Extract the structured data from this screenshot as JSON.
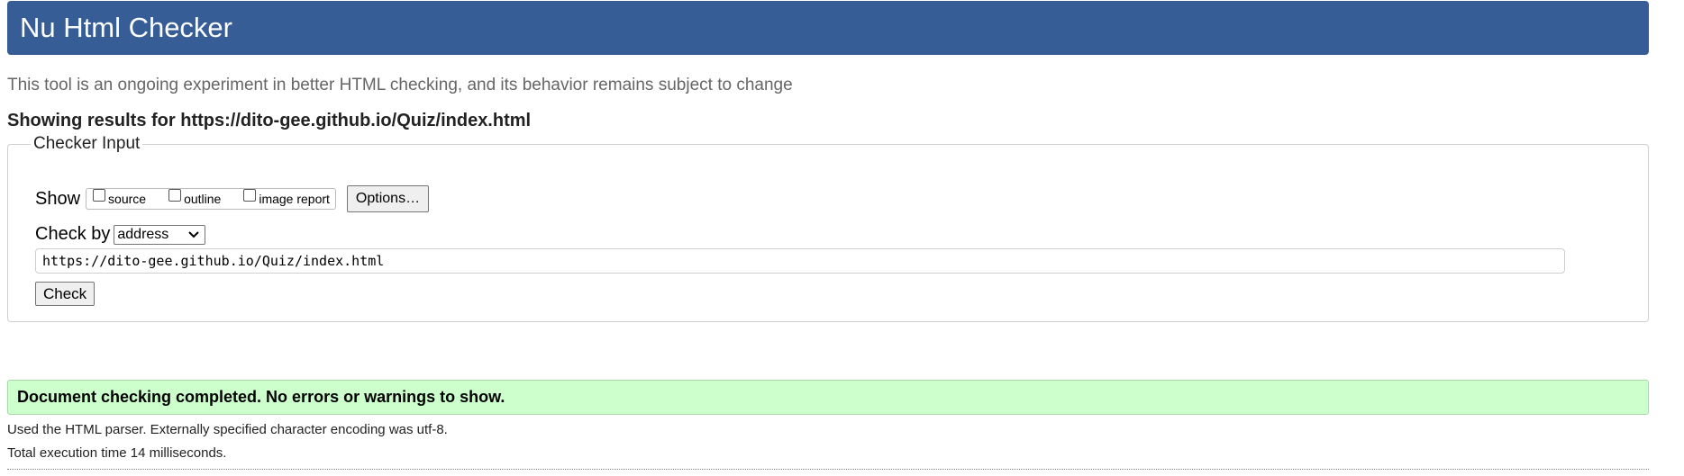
{
  "header": {
    "title": "Nu Html Checker"
  },
  "intro_text": "This tool is an ongoing experiment in better HTML checking, and its behavior remains subject to change",
  "results_for": "Showing results for https://dito-gee.github.io/Quiz/index.html",
  "checker_input": {
    "legend": "Checker Input",
    "show_label": "Show",
    "show_options": [
      {
        "label": "source",
        "checked": false
      },
      {
        "label": "outline",
        "checked": false
      },
      {
        "label": "image report",
        "checked": false
      }
    ],
    "options_button": "Options…",
    "check_by_label": "Check by",
    "check_by_selected": "address",
    "url_value": "https://dito-gee.github.io/Quiz/index.html",
    "check_button": "Check"
  },
  "result": {
    "message": "Document checking completed. No errors or warnings to show.",
    "parser_note": "Used the HTML parser. Externally specified character encoding was utf-8.",
    "exec_time": "Total execution time 14 milliseconds."
  },
  "colors": {
    "header_bg": "#365d95",
    "success_bg": "#ccffcc"
  }
}
